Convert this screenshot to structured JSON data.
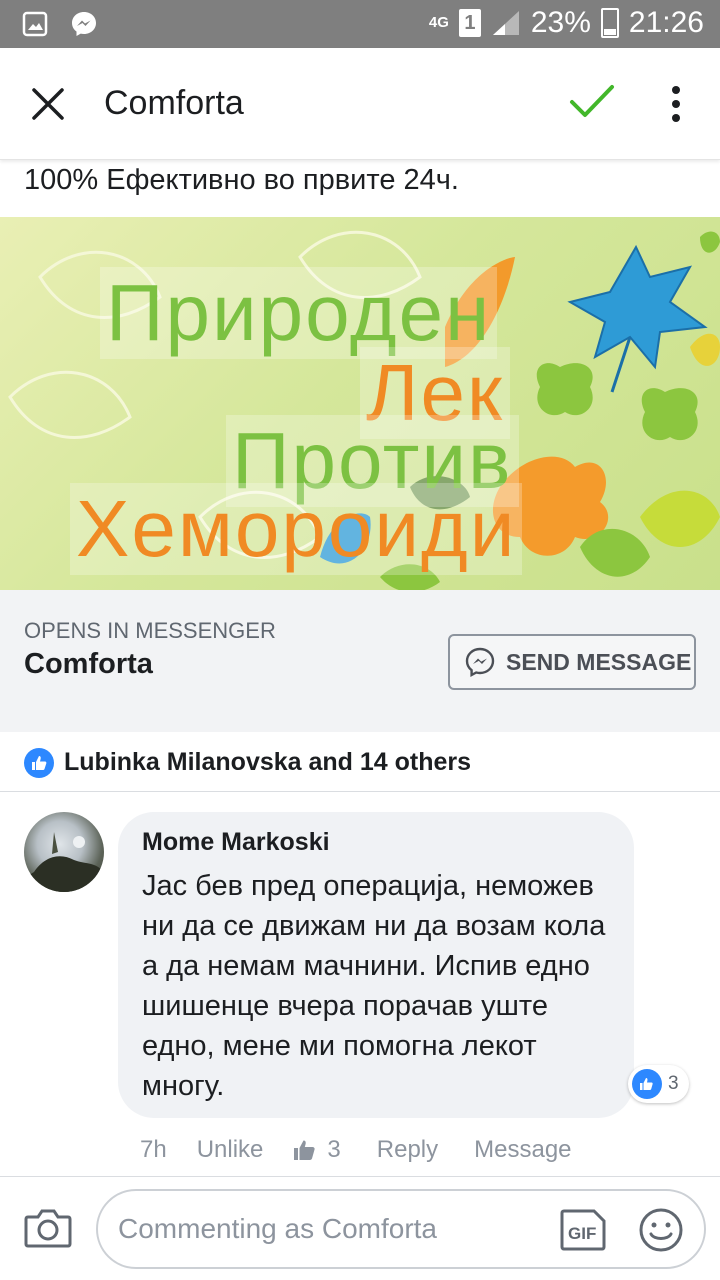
{
  "status_bar": {
    "network": "4G",
    "sim": "1",
    "battery": "23%",
    "time": "21:26"
  },
  "header": {
    "title": "Comforta"
  },
  "post": {
    "text": "100% Ефективно во првите 24ч.",
    "banner_lines": [
      "Природен",
      "Лек",
      "Против",
      "Хемороиди"
    ]
  },
  "cta": {
    "caption": "OPENS IN MESSENGER",
    "page_name": "Comforta",
    "button_label": "SEND MESSAGE"
  },
  "likes": {
    "text": "Lubinka Milanovska and 14 others"
  },
  "comment": {
    "author": "Mome Markoski",
    "body": "Јас бев пред операција, неможев ни да се движам ни да возам кола а да немам мачнини. Испив едно шишенце вчера порачав уште едно, мене ми помогна лекот многу.",
    "reaction_count": "3",
    "time": "7h",
    "unlike_label": "Unlike",
    "like_count": "3",
    "reply_label": "Reply",
    "message_label": "Message"
  },
  "composer": {
    "placeholder": "Commenting as Comforta",
    "gif_label": "GIF"
  },
  "colors": {
    "accent_blue": "#2d88ff",
    "check_green": "#42b72a",
    "banner_green": "#7cc142",
    "banner_orange": "#f08a24"
  }
}
